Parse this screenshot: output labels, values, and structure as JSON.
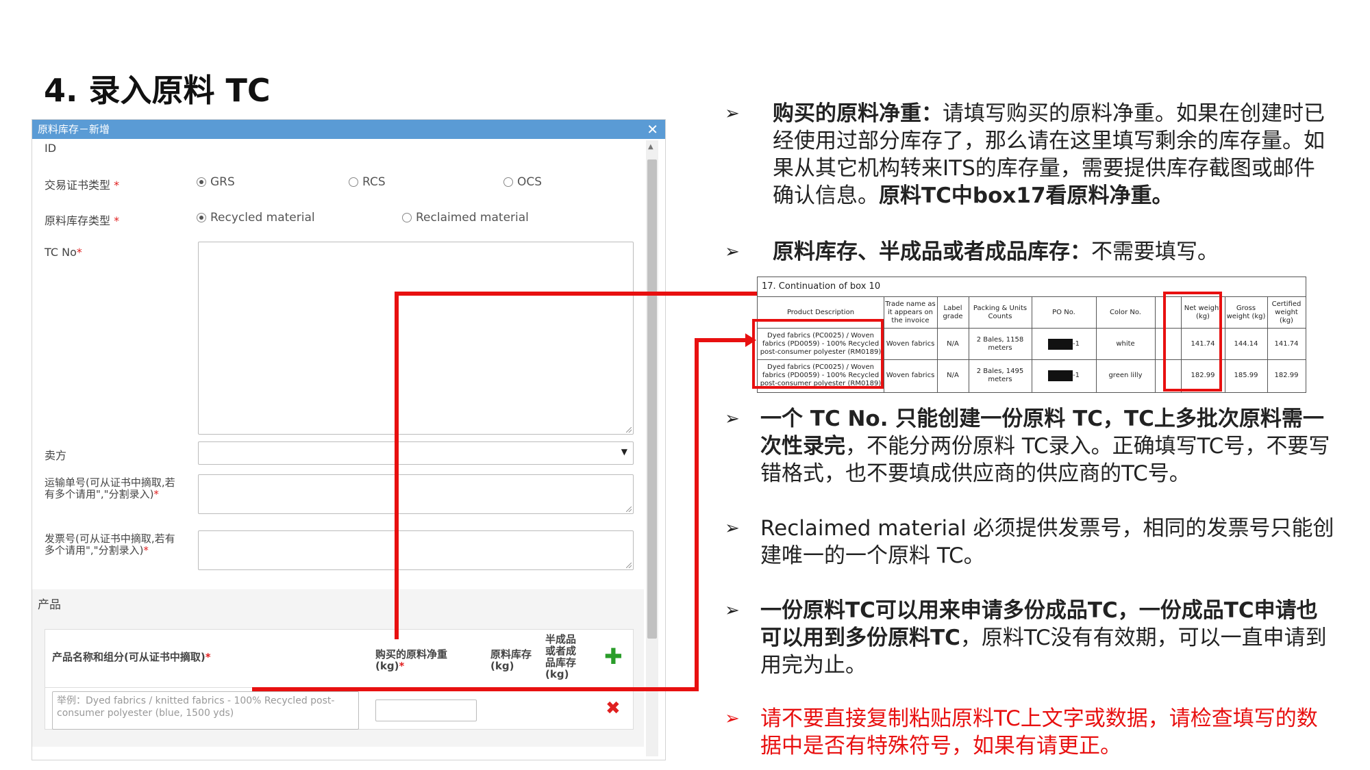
{
  "slide": {
    "title": "4. 录入原料 TC"
  },
  "dialog": {
    "title": "原料库存－新增",
    "id_label": "ID",
    "cert_type_label": "交易证书类型",
    "cert_types": [
      "GRS",
      "RCS",
      "OCS"
    ],
    "material_type_label": "原料库存类型",
    "material_types": [
      "Recycled material",
      "Reclaimed material"
    ],
    "tc_no_label": "TC No",
    "seller_label": "卖方",
    "shipping_label": "运输单号(可从证书中摘取,若有多个请用\",\"分割录入)",
    "invoice_label": "发票号(可从证书中摘取,若有多个请用\",\"分割录入)",
    "required_mark": "*",
    "product_section": "产品",
    "product_table": {
      "col_name": "产品名称和组分(可从证书中摘取)",
      "col_net_weight": "购买的原料净重(kg)",
      "col_stock": "原料库存(kg)",
      "col_semi": "半成品或者成品库存(kg)",
      "name_placeholder": "举例：Dyed fabrics / knitted fabrics - 100% Recycled post-consumer polyester (blue, 1500 yds)"
    }
  },
  "certificate": {
    "box_title": "17. Continuation of box 10",
    "headers": [
      "Product Description",
      "Trade name as it appears on the invoice",
      "Label grade",
      "Packing & Units Counts",
      "PO No.",
      "Color No.",
      "Net weight (kg)",
      "Gross weight (kg)",
      "Certified weight (kg)"
    ],
    "rows": [
      [
        "Dyed fabrics (PC0025) / Woven fabrics (PD0059) - 100% Recycled post-consumer polyester (RM0189)",
        "Woven fabrics",
        "N/A",
        "2 Bales, 1158 meters",
        "-1",
        "white",
        "141.74",
        "144.14",
        "141.74"
      ],
      [
        "Dyed fabrics (PC0025) / Woven fabrics (PD0059) - 100% Recycled post-consumer polyester (RM0189)",
        "Woven fabrics",
        "N/A",
        "2 Bales, 1495 meters",
        "-1",
        "green lilly",
        "182.99",
        "185.99",
        "182.99"
      ]
    ]
  },
  "bullets": {
    "b1_bold": "购买的原料净重：",
    "b1_text": "请填写购买的原料净重。如果在创建时已经使用过部分库存了，那么请在这里填写剩余的库存量。如果从其它机构转来ITS的库存量，需要提供库存截图或邮件确认信息。",
    "b1_bold2": "原料TC中box17看原料净重。",
    "b2_bold": "原料库存、半成品或者成品库存：",
    "b2_text": "不需要填写。",
    "b3_bold": "一个 TC No. 只能创建一份原料 TC，TC上多批次原料需一次性录完",
    "b3_text": "，不能分两份原料 TC录入。正确填写TC号，不要写错格式，也不要填成供应商的供应商的TC号。",
    "b4_text": "Reclaimed material 必须提供发票号，相同的发票号只能创建唯一的一个原料 TC。",
    "b5_bold": "一份原料TC可以用来申请多份成品TC，一份成品TC申请也可以用到多份原料TC",
    "b5_text": "，原料TC没有有效期，可以一直申请到用完为止。",
    "b6_text": "请不要直接复制粘贴原料TC上文字或数据，请检查填写的数据中是否有特殊符号，如果有请更正。"
  },
  "colors": {
    "accent_red": "#e81010",
    "titlebar_blue": "#5a9bd5",
    "add_green": "#2a9d2a"
  }
}
